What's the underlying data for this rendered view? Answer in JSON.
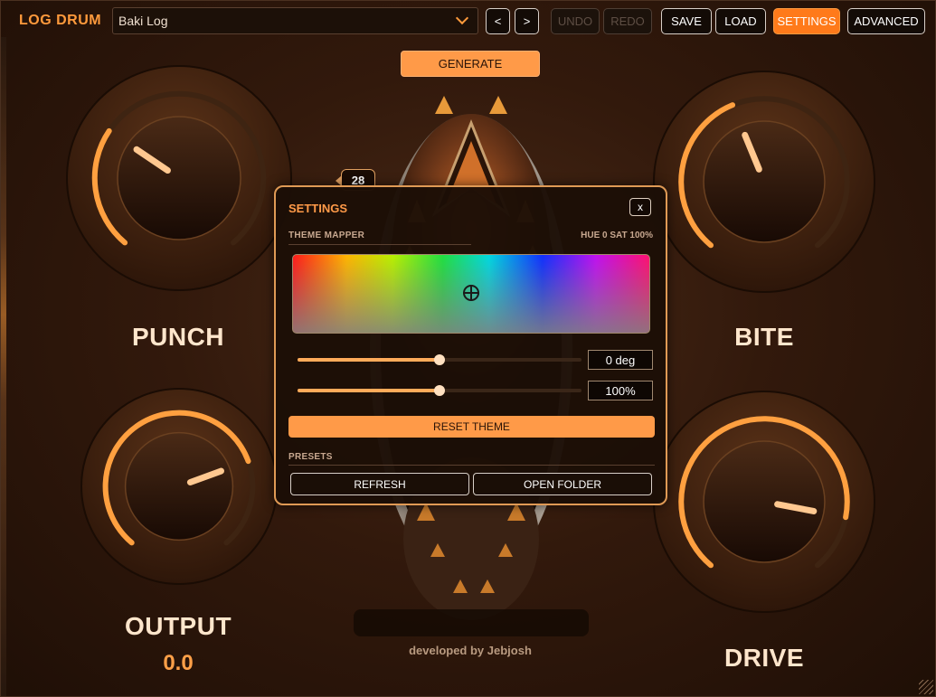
{
  "app": {
    "brand": "LOG DRUM"
  },
  "toolbar": {
    "preset_value": "Baki Log",
    "prev_label": "<",
    "next_label": ">",
    "undo_label": "UNDO",
    "redo_label": "REDO",
    "save_label": "SAVE",
    "load_label": "LOAD",
    "settings_label": "SETTINGS",
    "advanced_label": "ADVANCED"
  },
  "generate_label": "GENERATE",
  "knobs": {
    "punch": {
      "label": "PUNCH",
      "level": 0.3
    },
    "bite": {
      "label": "BITE",
      "level": 0.42
    },
    "output": {
      "label": "OUTPUT",
      "value": "0.0",
      "level": 0.75
    },
    "drive": {
      "label": "DRIVE",
      "level": 0.86
    }
  },
  "credit": "developed by Jebjosh",
  "settings": {
    "badge": "28",
    "title": "SETTINGS",
    "close_label": "x",
    "theme_mapper_label": "THEME MAPPER",
    "hue_sat_readout": "HUE 0  SAT 100%",
    "hue_value": "0 deg",
    "hue_level": 0.5,
    "sat_value": "100%",
    "sat_level": 0.5,
    "reset_label": "RESET THEME",
    "presets_label": "PRESETS",
    "refresh_label": "REFRESH",
    "open_folder_label": "OPEN FOLDER"
  },
  "colors": {
    "accent": "#ff9a48",
    "active_button": "#ff7a1a",
    "knob_arc": "#ffa040"
  }
}
